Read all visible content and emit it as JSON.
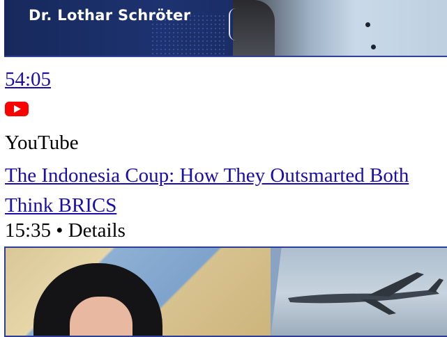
{
  "video1": {
    "thumbnail_name_text": "Dr. Lothar Schröter",
    "duration": "54:05"
  },
  "video2": {
    "source_icon": "youtube-icon",
    "source": "YouTube",
    "title_line1": "The Indonesia Coup: How They Outsmarted Both",
    "title_line2": "Think BRICS",
    "meta": "15:35 • Details"
  },
  "colors": {
    "link": "#1a0dab",
    "youtube_red": "#ff0000",
    "thumb_border": "#2b3f94"
  }
}
